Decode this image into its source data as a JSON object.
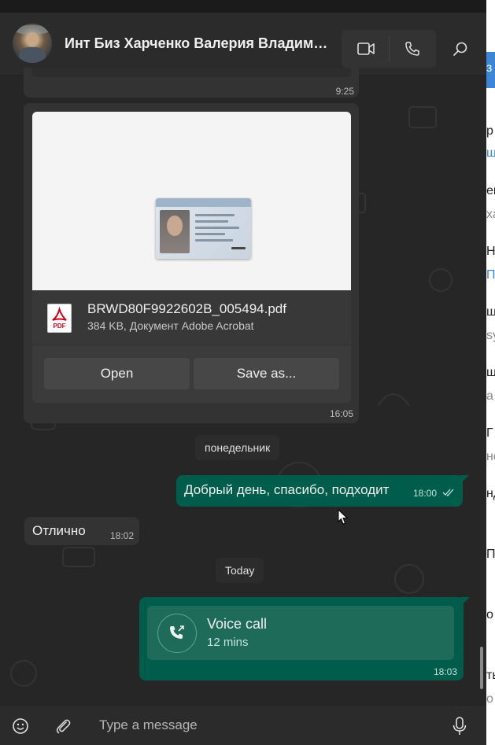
{
  "header": {
    "title": "Инт Биз Харченко Валерия Владимиро...",
    "icons": [
      "video-call-icon",
      "voice-call-icon",
      "search-icon"
    ]
  },
  "messages": {
    "prev_time": "9:25",
    "document": {
      "file_name": "BRWD80F9922602B_005494.pdf",
      "file_meta": "384 KB, Документ Adobe Acrobat",
      "pdf_label": "PDF",
      "open_label": "Open",
      "save_label": "Save as...",
      "time": "16:05"
    },
    "day1": "понедельник",
    "out1": {
      "text": "Добрый день, спасибо, подходит",
      "time": "18:00",
      "status": "read"
    },
    "in1": {
      "text": "Отлично",
      "time": "18:02"
    },
    "day2": "Today",
    "call": {
      "title": "Voice call",
      "duration": "12 mins",
      "time": "18:03"
    }
  },
  "composer": {
    "placeholder": "Type a message"
  },
  "right_window": {
    "fragments": [
      "з д",
      "р",
      "щ",
      "ев",
      "ха",
      "Ни",
      "П",
      "щ",
      "sy",
      "ш",
      "а",
      "Г",
      "но",
      "нд",
      "П",
      "о",
      "ть",
      "о"
    ]
  },
  "colors": {
    "outgoing_bubble": "#005c4b",
    "incoming_bubble": "#333333",
    "chat_background": "#262626",
    "accent_blue": "#3d86d6"
  }
}
